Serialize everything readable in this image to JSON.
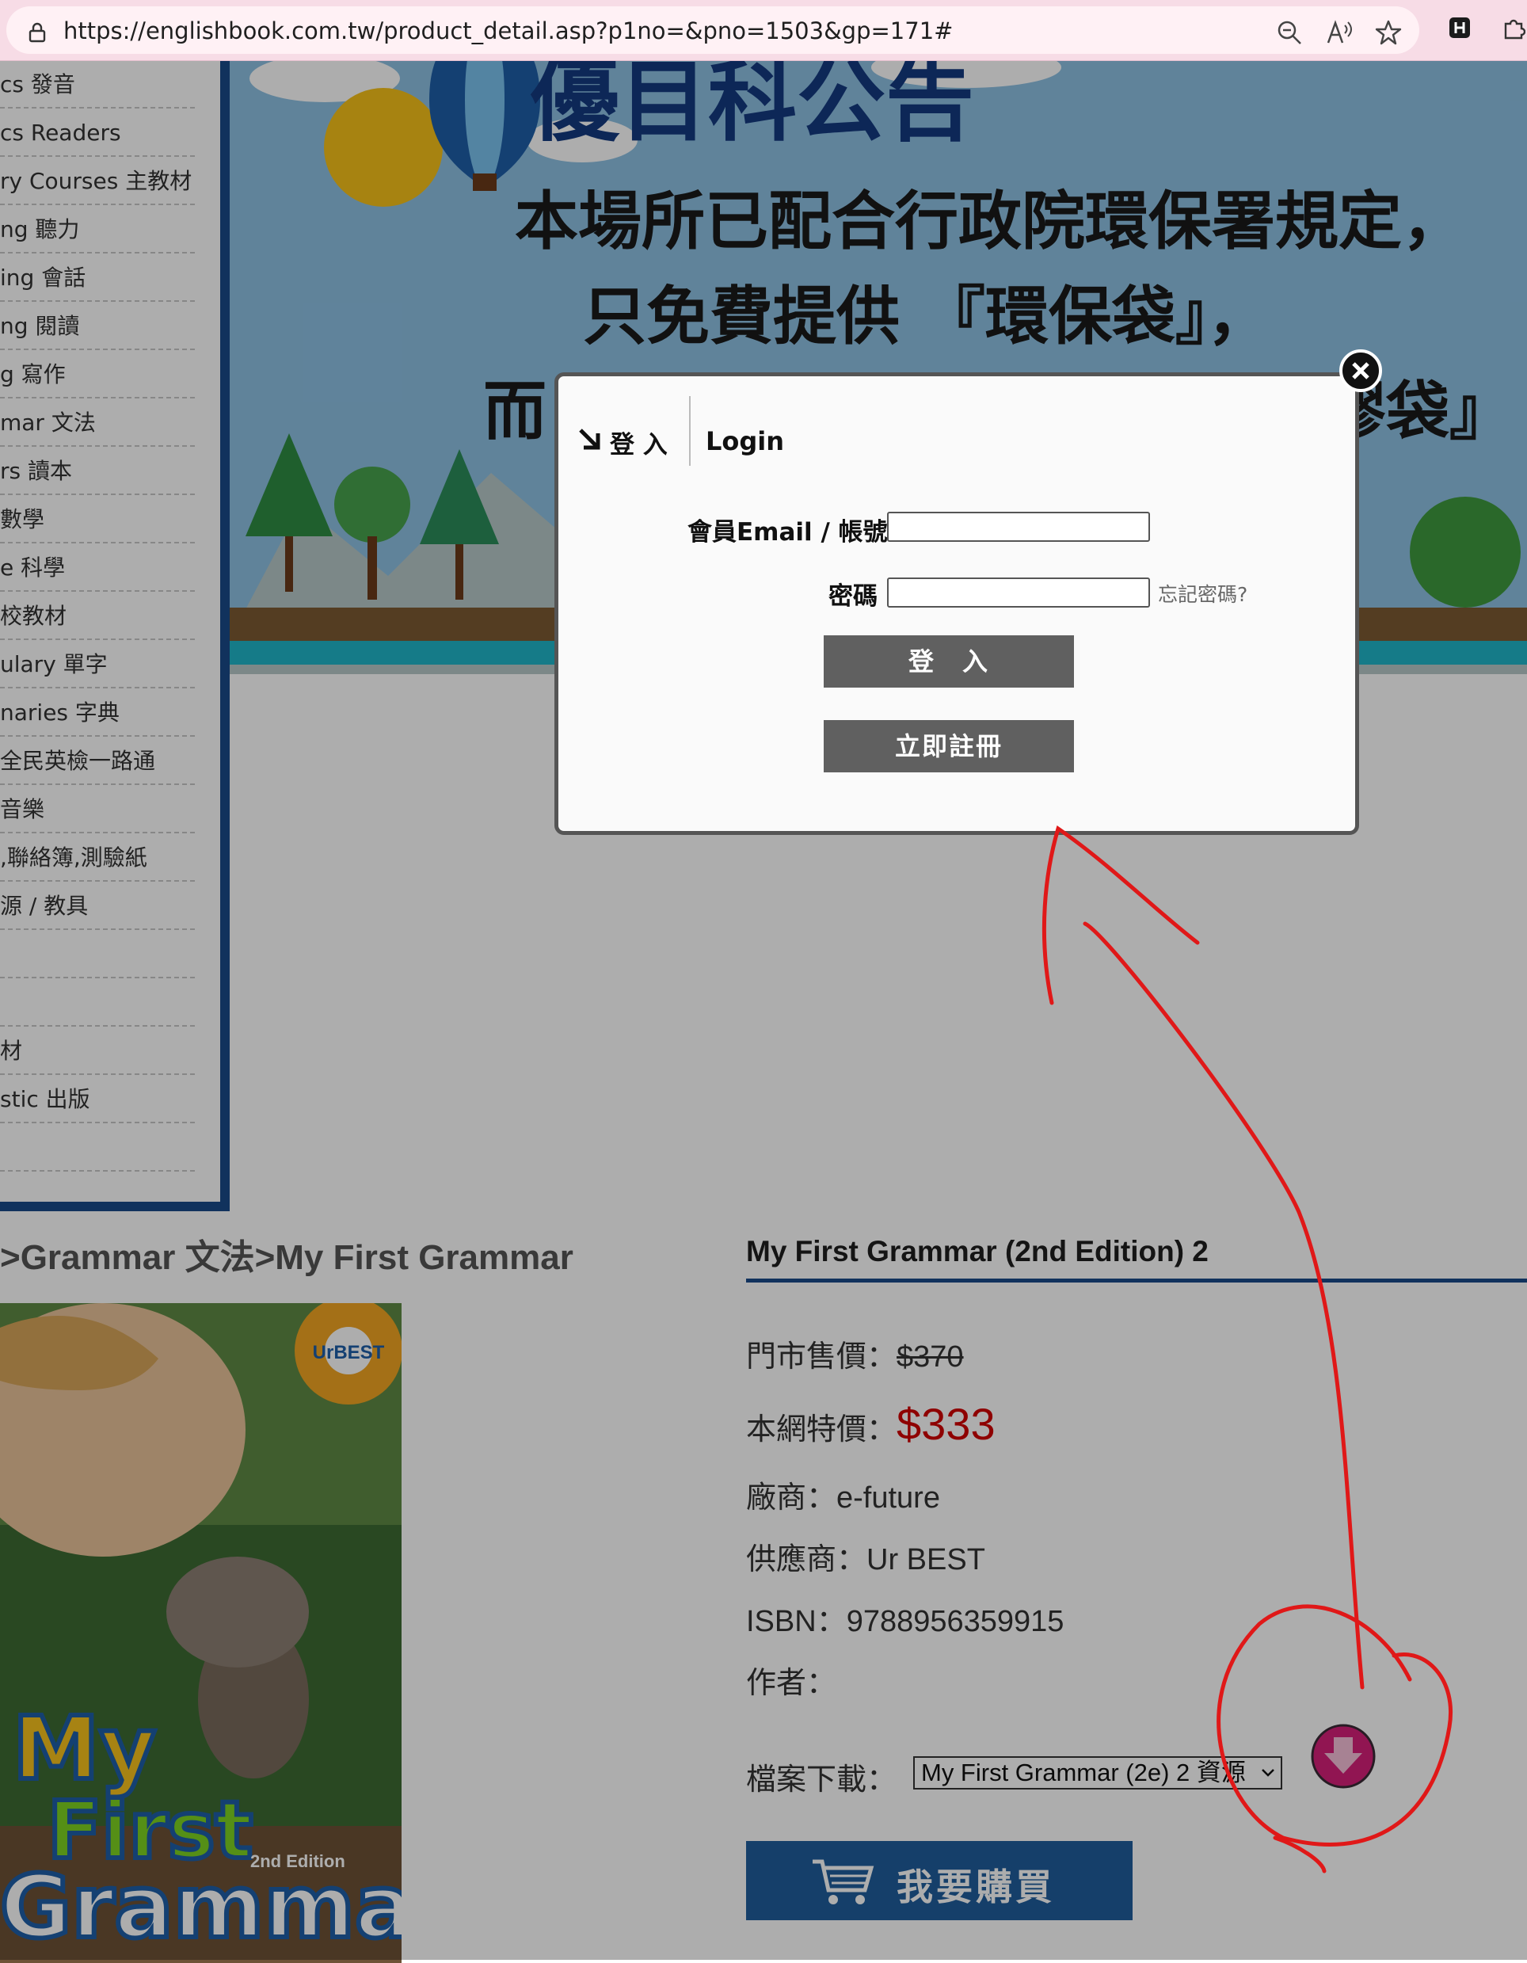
{
  "browser": {
    "url": "https://englishbook.com.tw/product_detail.asp?p1no=&pno=1503&gp=171#",
    "tools": [
      "zoom-out-icon",
      "read-aloud-icon",
      "favorite-star-icon"
    ],
    "extensions": [
      "h-extension-icon",
      "puzzle-extension-icon"
    ]
  },
  "sidebar": {
    "items": [
      {
        "label": "cs 發音"
      },
      {
        "label": "cs Readers"
      },
      {
        "label": "ry Courses 主教材"
      },
      {
        "label": "ng 聽力"
      },
      {
        "label": "ing 會話"
      },
      {
        "label": "ng 閱讀"
      },
      {
        "label": "g 寫作"
      },
      {
        "label": "mar 文法"
      },
      {
        "label": "rs 讀本"
      },
      {
        "label": "數學"
      },
      {
        "label": "e 科學"
      },
      {
        "label": "校教材"
      },
      {
        "label": "ulary 單字"
      },
      {
        "label": "naries 字典"
      },
      {
        "label": "全民英檢一路通"
      },
      {
        "label": "音樂"
      },
      {
        "label": ",聯絡簿,測驗紙"
      },
      {
        "label": "源 / 教具"
      },
      {
        "label": ""
      },
      {
        "label": ""
      },
      {
        "label": "材"
      },
      {
        "label": "stic 出版"
      },
      {
        "label": ""
      }
    ]
  },
  "banner": {
    "heading": "優目科公告",
    "line1": "本場所已配合行政院環保署規定，",
    "line2": "只免費提供 『環保袋』，",
    "line3_left": "而",
    "line3_right": "膠袋』"
  },
  "breadcrumb": ">Grammar 文法>My First Grammar",
  "product": {
    "title": "My First Grammar (2nd Edition) 2",
    "retail_label": "門市售價：",
    "retail_price": "$370",
    "web_label": "本網特價：",
    "web_price": "$333",
    "publisher_label": "廠商：",
    "publisher": "e-future",
    "supplier_label": "供應商：",
    "supplier": "Ur BEST",
    "isbn_label": "ISBN：",
    "isbn": "9788956359915",
    "author_label": "作者：",
    "author": "",
    "download_label": "檔案下載：",
    "download_selected": "My First Grammar (2e) 2 資源",
    "buy_label": "我要購買"
  },
  "book_cover": {
    "title_line1": "My",
    "title_line2": "First",
    "title_line3": "Grammar",
    "edition": "2nd Edition",
    "badge": "UrBEST"
  },
  "login_modal": {
    "tab_zh": "登 入",
    "tab_en": "Login",
    "account_label": "會員Email / 帳號",
    "account_value": "",
    "password_label": "密碼",
    "password_value": "",
    "forgot_label": "忘記密碼?",
    "login_button": "登　入",
    "register_button": "立即註冊"
  },
  "colors": {
    "sidebar_border": "#1a4a8a",
    "price_red": "#d10000",
    "buy_blue": "#1f5d9d",
    "annotation_red": "#e01818",
    "modal_button": "#606060"
  }
}
